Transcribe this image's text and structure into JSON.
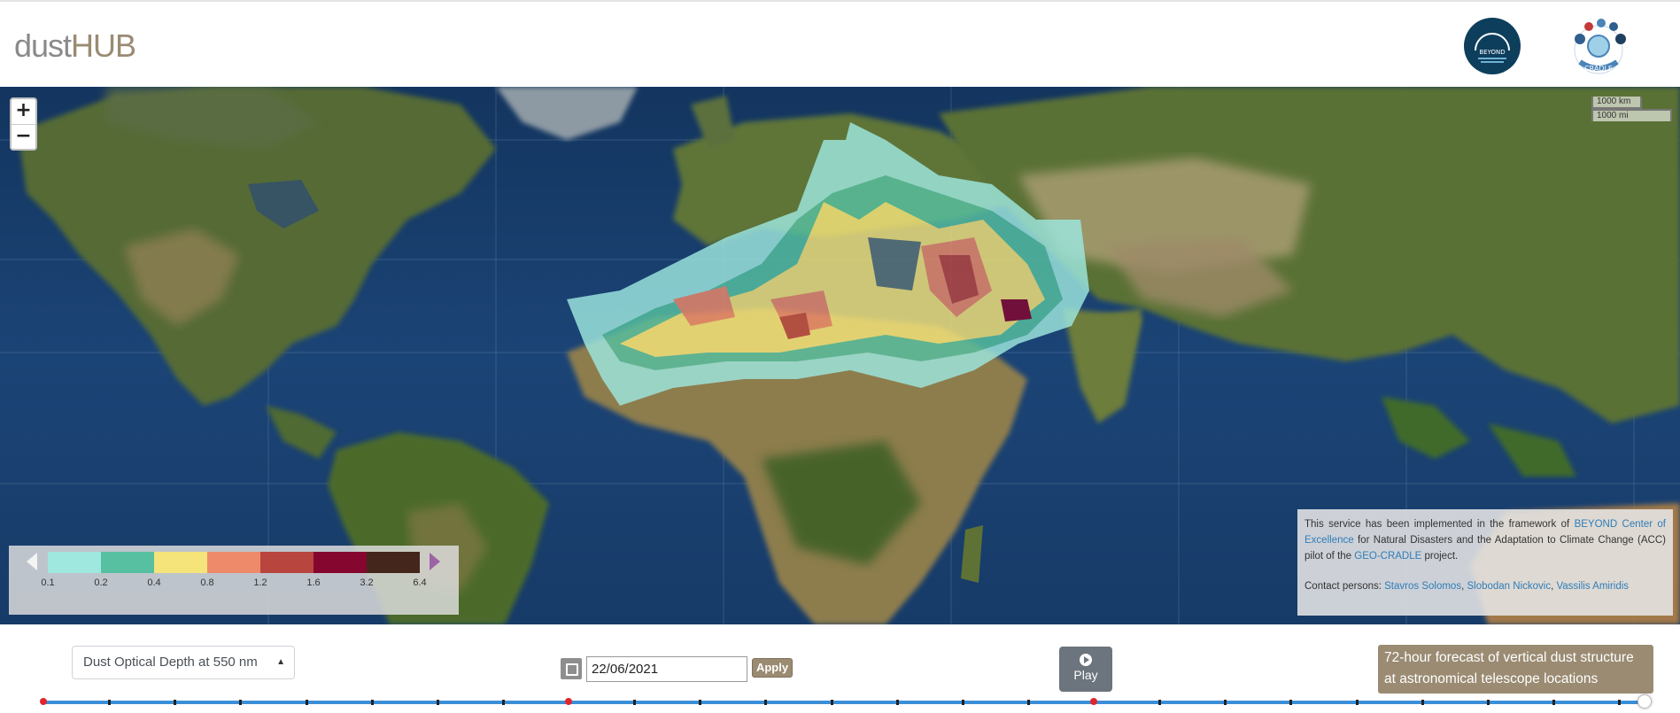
{
  "header": {
    "logo_part1": "dust",
    "logo_part2": "HUB",
    "logo_colors": {
      "dust": "#8a8a8a",
      "hub": "#9a8b72"
    },
    "partner_logos": [
      "BEYOND",
      "CRADLE"
    ]
  },
  "map": {
    "zoom_in": "+",
    "zoom_out": "−",
    "scale_km": "1000 km",
    "scale_mi": "1000 mi"
  },
  "legend": {
    "colors": [
      "#9ee8e0",
      "#56c0a0",
      "#f5e47a",
      "#ee8a6a",
      "#b9453f",
      "#85062e",
      "#45261c"
    ],
    "ticks": [
      "0.1",
      "0.2",
      "0.4",
      "0.8",
      "1.2",
      "1.6",
      "3.2",
      "6.4"
    ]
  },
  "info": {
    "text1": "This service has been implemented in the framework of ",
    "link1": "BEYOND Center of Excellence",
    "text2": " for Natural Disasters and the Adaptation to Climate Change (ACC) pilot of the ",
    "link2": "GEO-CRADLE",
    "text3": " project.",
    "contact_label": "Contact persons: ",
    "person1": "Stavros Solomos",
    "person2": "Slobodan Nickovic",
    "person3": "Vassilis Amiridis",
    "sep": ", "
  },
  "controls": {
    "variable_select": "Dust Optical Depth at 550 nm",
    "date_value": "22/06/2021",
    "apply_label": "Apply",
    "play_label": "Play",
    "forecast_label": "72-hour forecast of vertical dust structure at astronomical telescope locations"
  },
  "timeline": {
    "steps": 24,
    "current_step": 23,
    "day_markers": [
      0,
      8,
      16
    ]
  }
}
